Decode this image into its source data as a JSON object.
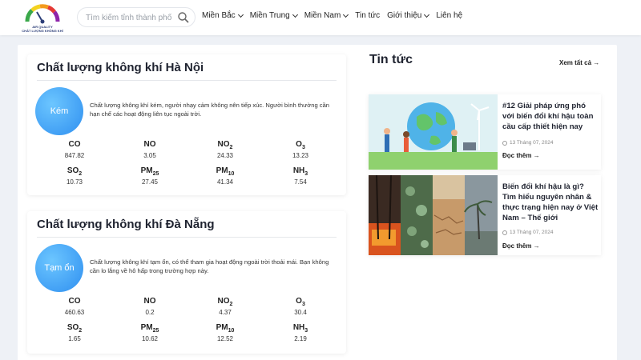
{
  "header": {
    "logo_text_top": "AIR QUALITY",
    "logo_text": "CHẤT LƯỢNG KHÔNG KHÍ",
    "search_placeholder": "Tìm kiếm tỉnh thành phố",
    "nav": [
      {
        "label": "Miền Bắc",
        "has_dropdown": true
      },
      {
        "label": "Miền Trung",
        "has_dropdown": true
      },
      {
        "label": "Miền Nam",
        "has_dropdown": true
      },
      {
        "label": "Tin tức",
        "has_dropdown": false
      },
      {
        "label": "Giới thiệu",
        "has_dropdown": true
      },
      {
        "label": "Liên hệ",
        "has_dropdown": false
      }
    ]
  },
  "cities": [
    {
      "title": "Chất lượng không khí Hà Nội",
      "status": "Kém",
      "description": "Chất lượng không khí kém, người nhạy cảm không nên tiếp xúc. Người bình thường cần hạn chế các hoạt động liên tục ngoài trời.",
      "pollutants": [
        {
          "name": "CO",
          "sub": "",
          "value": "847.82"
        },
        {
          "name": "NO",
          "sub": "",
          "value": "3.05"
        },
        {
          "name": "NO",
          "sub": "2",
          "value": "24.33"
        },
        {
          "name": "O",
          "sub": "3",
          "value": "13.23"
        },
        {
          "name": "SO",
          "sub": "2",
          "value": "10.73"
        },
        {
          "name": "PM",
          "sub": "25",
          "value": "27.45"
        },
        {
          "name": "PM",
          "sub": "10",
          "value": "41.34"
        },
        {
          "name": "NH",
          "sub": "3",
          "value": "7.54"
        }
      ]
    },
    {
      "title": "Chất lượng không khí Đà Nẵng",
      "status": "Tạm ổn",
      "description": "Chất lượng không khí tạm ổn, có thể tham gia hoạt động ngoài trời thoải mái. Bạn không cần lo lắng về hô hấp trong trường hợp này.",
      "pollutants": [
        {
          "name": "CO",
          "sub": "",
          "value": "460.63"
        },
        {
          "name": "NO",
          "sub": "",
          "value": "0.2"
        },
        {
          "name": "NO",
          "sub": "2",
          "value": "4.37"
        },
        {
          "name": "O",
          "sub": "3",
          "value": "30.4"
        },
        {
          "name": "SO",
          "sub": "2",
          "value": "1.65"
        },
        {
          "name": "PM",
          "sub": "25",
          "value": "10.62"
        },
        {
          "name": "PM",
          "sub": "10",
          "value": "12.52"
        },
        {
          "name": "NH",
          "sub": "3",
          "value": "2.19"
        }
      ]
    }
  ],
  "news": {
    "title": "Tin tức",
    "see_all": "Xem tất cả →",
    "items": [
      {
        "headline": "#12 Giải pháp ứng phó với biến đổi khí hậu toàn cầu cấp thiết hiện nay",
        "date": "13 Tháng 07, 2024",
        "read_more": "Đọc thêm →"
      },
      {
        "headline": "Biến đổi khí hậu là gì? Tìm hiểu nguyên nhân & thực trạng hiện nay ở Việt Nam – Thế giới",
        "date": "13 Tháng 07, 2024",
        "read_more": "Đọc thêm →"
      }
    ]
  },
  "colors": {
    "accent": "#2f8ff0",
    "circle_light": "#6cc6ff",
    "background": "#eef1f6"
  },
  "icons": {
    "search": "search-icon",
    "clock": "clock-icon",
    "logo": "aqi-gauge-logo"
  }
}
